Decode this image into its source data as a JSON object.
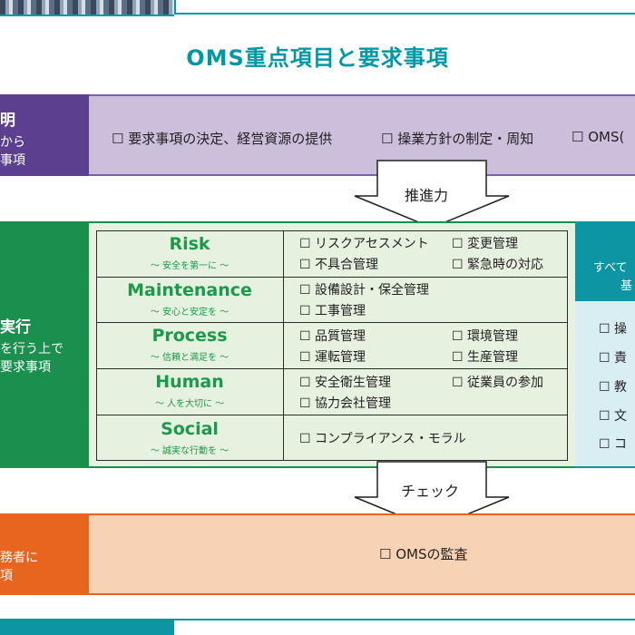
{
  "title": "OMS重点項目と要求事項",
  "row1": {
    "label_lines": [
      "明",
      "から",
      "事項"
    ],
    "items": [
      "☐ 要求事項の決定、経営資源の提供",
      "☐ 操業方針の制定・周知",
      "☐ OMS("
    ]
  },
  "arrow1": {
    "label": "推進力"
  },
  "row2": {
    "label_lines": [
      "実行",
      "を行う上で",
      "要求事項"
    ],
    "categories": [
      {
        "name": "Risk",
        "sub": "～ 安全を第一に ～",
        "items_left": [
          "☐ リスクアセスメント",
          "☐ 不具合管理"
        ],
        "items_right": [
          "☐ 変更管理",
          "☐ 緊急時の対応"
        ]
      },
      {
        "name": "Maintenance",
        "sub": "～ 安心と安定を ～",
        "items_left": [
          "☐ 設備設計・保全管理",
          "☐ 工事管理"
        ],
        "items_right": []
      },
      {
        "name": "Process",
        "sub": "～ 信頼と満足を ～",
        "items_left": [
          "☐ 品質管理",
          "☐ 運転管理"
        ],
        "items_right": [
          "☐ 環境管理",
          "☐ 生産管理"
        ]
      },
      {
        "name": "Human",
        "sub": "～ 人を大切に ～",
        "items_left": [
          "☐ 安全衛生管理",
          "☐ 協力会社管理"
        ],
        "items_right": [
          "☐ 従業員の参加"
        ]
      },
      {
        "name": "Social",
        "sub": "～ 誠実な行動を ～",
        "items_left": [
          "☐ コンプライアンス・モラル"
        ],
        "items_right": []
      }
    ]
  },
  "right_panel": {
    "head_lines": [
      "すべて",
      "基"
    ],
    "items": [
      "☐ 操",
      "☐ 責",
      "☐ 教",
      "☐ 文",
      "☐ コ"
    ]
  },
  "arrow2": {
    "label": "チェック"
  },
  "row3": {
    "label_lines": [
      "務者に",
      "項"
    ],
    "item": "☐ OMSの監査"
  }
}
